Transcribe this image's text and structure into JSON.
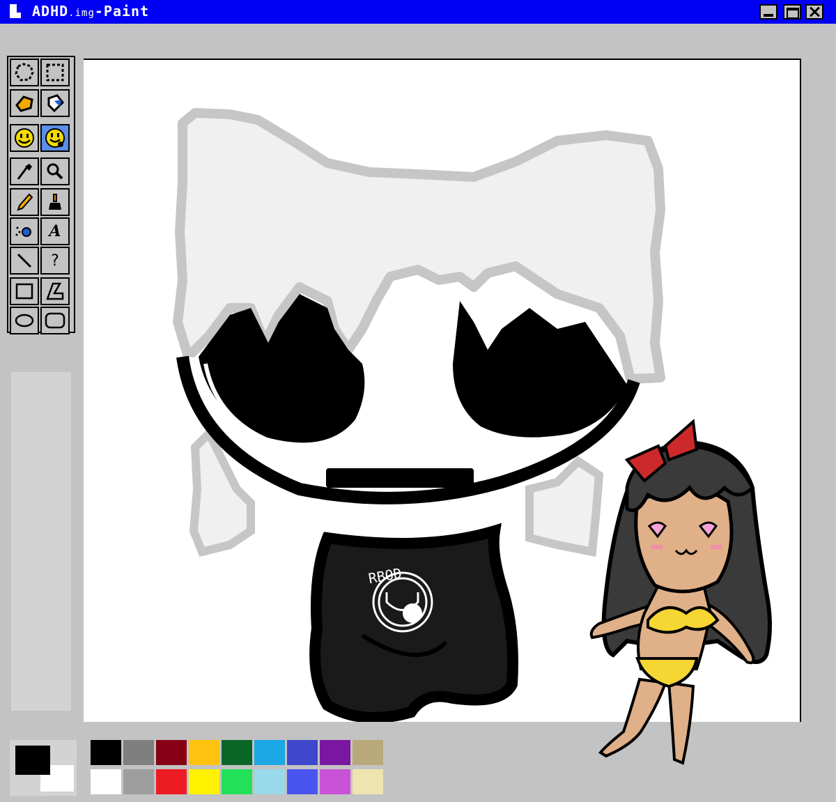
{
  "window": {
    "title_main": "ADHD",
    "title_small": ".img",
    "title_suffix": "-Paint"
  },
  "toolbox": {
    "tools": [
      {
        "name": "free-select-icon"
      },
      {
        "name": "rect-select-icon"
      },
      {
        "name": "eraser-icon"
      },
      {
        "name": "fill-icon"
      },
      {
        "name": "smiley-icon"
      },
      {
        "name": "smiley-alt-icon"
      },
      {
        "name": "color-picker-icon"
      },
      {
        "name": "magnifier-icon"
      },
      {
        "name": "pencil-icon"
      },
      {
        "name": "brush-icon"
      },
      {
        "name": "airbrush-icon"
      },
      {
        "name": "text-icon"
      },
      {
        "name": "line-icon"
      },
      {
        "name": "curve-icon"
      },
      {
        "name": "rectangle-icon"
      },
      {
        "name": "polygon-icon"
      },
      {
        "name": "ellipse-icon"
      },
      {
        "name": "rounded-rect-icon"
      }
    ],
    "text_tool_label": "A",
    "curve_tool_label": "?"
  },
  "current_colors": {
    "foreground": "#000000",
    "background": "#ffffff"
  },
  "palette": {
    "top": [
      "#000000",
      "#7f7f7f",
      "#880015",
      "#ffc20e",
      "#0a6626",
      "#1ca7e5",
      "#3f48cc",
      "#7a16a0",
      "#b9a97a"
    ],
    "bottom": [
      "#ffffff",
      "#9e9e9e",
      "#ed1c24",
      "#fff200",
      "#22e158",
      "#99d9ea",
      "#4a55f0",
      "#c853d6",
      "#efe4b0"
    ]
  },
  "artwork": {
    "shirt_text": "RBOD"
  }
}
